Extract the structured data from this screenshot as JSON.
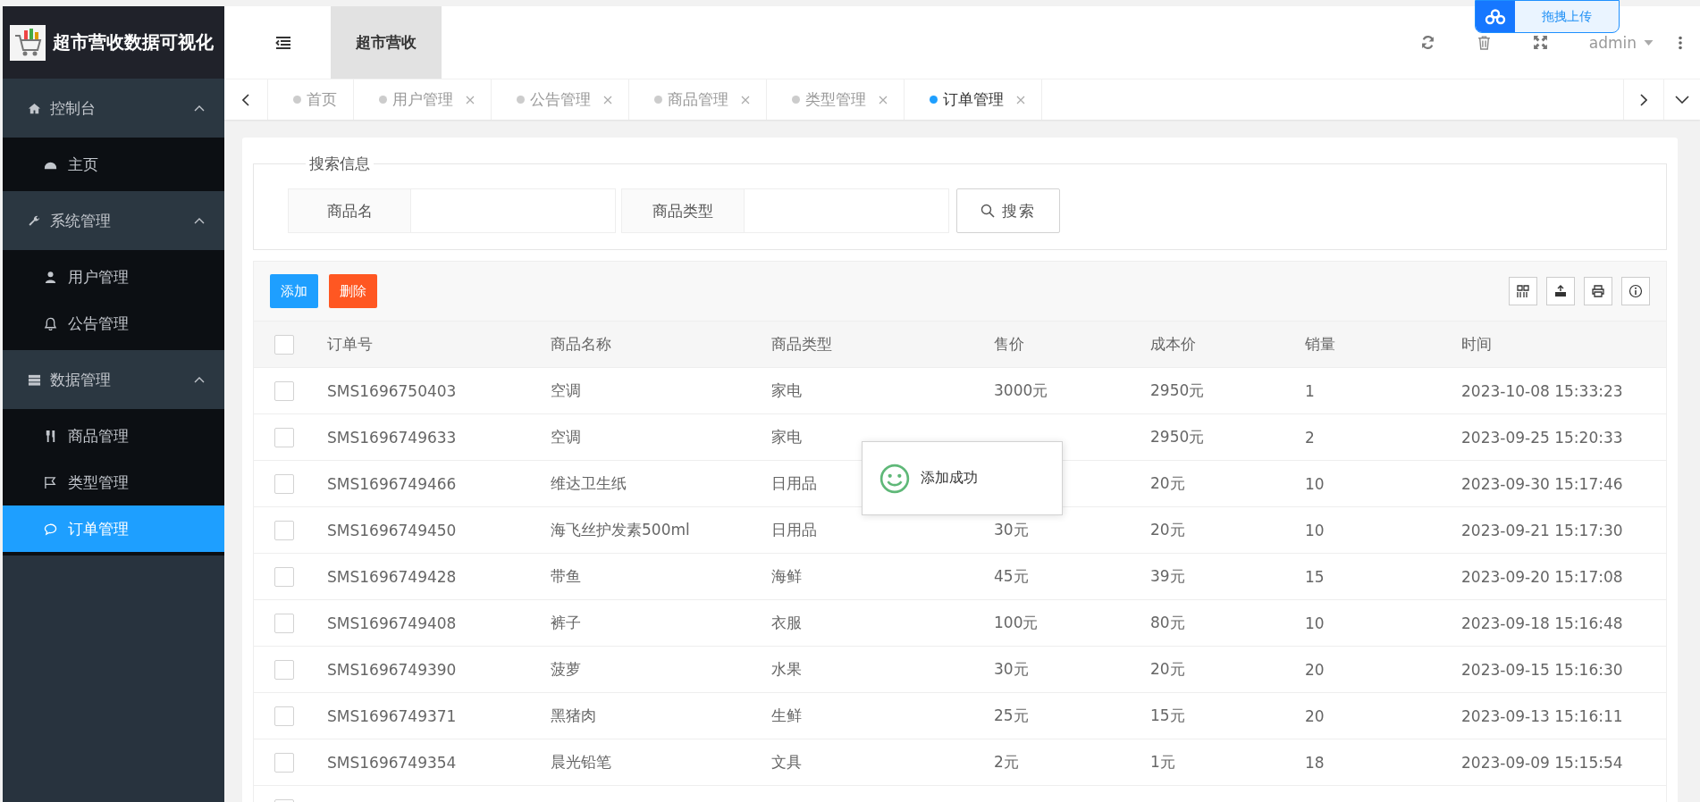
{
  "brand": {
    "title": "超市营收数据可视化"
  },
  "sidebar": {
    "groups": [
      {
        "label": "控制台",
        "expanded": true,
        "children": [
          {
            "label": "主页",
            "selected": false
          }
        ]
      },
      {
        "label": "系统管理",
        "expanded": true,
        "children": [
          {
            "label": "用户管理",
            "selected": false
          },
          {
            "label": "公告管理",
            "selected": false
          }
        ]
      },
      {
        "label": "数据管理",
        "expanded": true,
        "children": [
          {
            "label": "商品管理",
            "selected": false
          },
          {
            "label": "类型管理",
            "selected": false
          },
          {
            "label": "订单管理",
            "selected": true
          }
        ]
      }
    ]
  },
  "header": {
    "title": "超市营收",
    "user": "admin"
  },
  "upload_widget": {
    "label": "拖拽上传"
  },
  "tabs": [
    {
      "label": "首页",
      "selected": false,
      "closable": false
    },
    {
      "label": "用户管理",
      "selected": false,
      "closable": true
    },
    {
      "label": "公告管理",
      "selected": false,
      "closable": true
    },
    {
      "label": "商品管理",
      "selected": false,
      "closable": true
    },
    {
      "label": "类型管理",
      "selected": false,
      "closable": true
    },
    {
      "label": "订单管理",
      "selected": true,
      "closable": true
    }
  ],
  "search": {
    "legend": "搜索信息",
    "fields": [
      {
        "label": "商品名"
      },
      {
        "label": "商品类型"
      }
    ],
    "button": "搜索"
  },
  "toolbar": {
    "buttons": [
      {
        "label": "添加",
        "kind": "primary"
      },
      {
        "label": "删除",
        "kind": "danger"
      }
    ]
  },
  "table": {
    "select_all_checked": false,
    "columns": [
      "订单号",
      "商品名称",
      "商品类型",
      "售价",
      "成本价",
      "销量",
      "时间"
    ],
    "rows": [
      {
        "checked": false,
        "cells": [
          "SMS1696750403",
          "空调",
          "家电",
          "3000元",
          "2950元",
          "1",
          "2023-10-08 15:33:23"
        ]
      },
      {
        "checked": false,
        "cells": [
          "SMS1696749633",
          "空调",
          "家电",
          null,
          "2950元",
          "2",
          "2023-09-25 15:20:33"
        ]
      },
      {
        "checked": false,
        "cells": [
          "SMS1696749466",
          "维达卫生纸",
          "日用品",
          null,
          "20元",
          "10",
          "2023-09-30 15:17:46"
        ]
      },
      {
        "checked": false,
        "cells": [
          "SMS1696749450",
          "海飞丝护发素500ml",
          "日用品",
          "30元",
          "20元",
          "10",
          "2023-09-21 15:17:30"
        ]
      },
      {
        "checked": false,
        "cells": [
          "SMS1696749428",
          "带鱼",
          "海鲜",
          "45元",
          "39元",
          "15",
          "2023-09-20 15:17:08"
        ]
      },
      {
        "checked": false,
        "cells": [
          "SMS1696749408",
          "裤子",
          "衣服",
          "100元",
          "80元",
          "10",
          "2023-09-18 15:16:48"
        ]
      },
      {
        "checked": false,
        "cells": [
          "SMS1696749390",
          "菠萝",
          "水果",
          "30元",
          "20元",
          "20",
          "2023-09-15 15:16:30"
        ]
      },
      {
        "checked": false,
        "cells": [
          "SMS1696749371",
          "黑猪肉",
          "生鲜",
          "25元",
          "15元",
          "20",
          "2023-09-13 15:16:11"
        ]
      },
      {
        "checked": false,
        "cells": [
          "SMS1696749354",
          "晨光铅笔",
          "文具",
          "2元",
          "1元",
          "18",
          "2023-09-09 15:15:54"
        ]
      }
    ],
    "partial_row": {
      "checked": false
    }
  },
  "toast": {
    "message": "添加成功"
  }
}
